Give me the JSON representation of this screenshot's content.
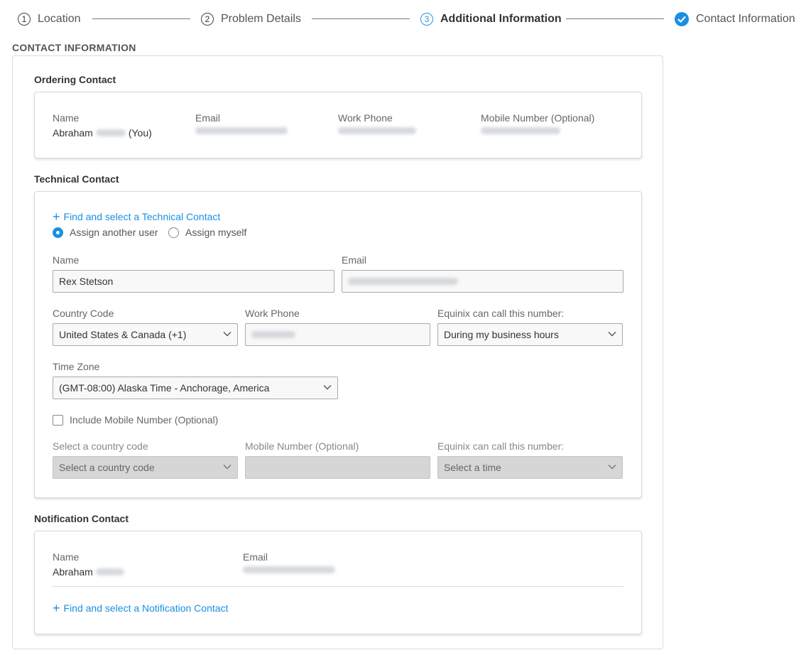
{
  "stepper": {
    "steps": [
      {
        "num": "1",
        "label": "Location"
      },
      {
        "num": "2",
        "label": "Problem Details"
      },
      {
        "num": "3",
        "label": "Additional Information"
      },
      {
        "num": "",
        "label": "Contact Information"
      }
    ]
  },
  "page": {
    "section_title": "CONTACT INFORMATION"
  },
  "ordering": {
    "title": "Ordering Contact",
    "name_label": "Name",
    "name_first": "Abraham",
    "name_suffix": "(You)",
    "email_label": "Email",
    "work_phone_label": "Work Phone",
    "mobile_label": "Mobile Number (Optional)"
  },
  "technical": {
    "title": "Technical Contact",
    "find_link": "Find and select a Technical Contact",
    "radio_another": "Assign another user",
    "radio_myself": "Assign myself",
    "name_label": "Name",
    "name_value": "Rex Stetson",
    "email_label": "Email",
    "country_code_label": "Country Code",
    "country_code_value": "United States & Canada (+1)",
    "work_phone_label": "Work Phone",
    "call_label": "Equinix can call this number:",
    "call_value": "During my business hours",
    "timezone_label": "Time Zone",
    "timezone_value": "(GMT-08:00) Alaska Time - Anchorage, America",
    "include_mobile": "Include Mobile Number (Optional)",
    "mobile_country_label": "Select a country code",
    "mobile_country_value": "Select a country code",
    "mobile_label": "Mobile Number (Optional)",
    "mobile_call_label": "Equinix can call this number:",
    "mobile_call_value": "Select a time"
  },
  "notification": {
    "title": "Notification Contact",
    "name_label": "Name",
    "name_first": "Abraham",
    "email_label": "Email",
    "find_link": "Find and select a Notification Contact"
  },
  "colors": {
    "accent": "#1a8fe3",
    "disabled": "#d6d6d6"
  }
}
